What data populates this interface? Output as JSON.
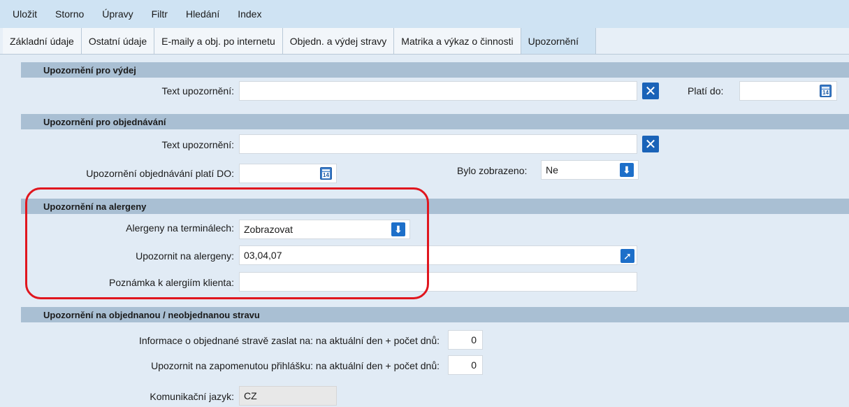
{
  "menu": [
    "Uložit",
    "Storno",
    "Úpravy",
    "Filtr",
    "Hledání",
    "Index"
  ],
  "tabs": [
    "Základní údaje",
    "Ostatní údaje",
    "E-maily a obj. po internetu",
    "Objedn. a výdej stravy",
    "Matrika a výkaz o činnosti",
    "Upozornění"
  ],
  "active_tab": "Upozornění",
  "s1": {
    "header": "Upozornění pro výdej",
    "text_label": "Text upozornění:",
    "text_value": "",
    "valid_label": "Platí do:",
    "valid_value": ""
  },
  "s2": {
    "header": "Upozornění pro objednávání",
    "text_label": "Text upozornění:",
    "text_value": "",
    "date_label": "Upozornění objednávání platí DO:",
    "date_value": "",
    "shown_label": "Bylo zobrazeno:",
    "shown_value": "Ne"
  },
  "s3": {
    "header": "Upozornění na alergeny",
    "terminals_label": "Alergeny na terminálech:",
    "terminals_value": "Zobrazovat",
    "notify_label": "Upozornit na alergeny:",
    "notify_value": "03,04,07",
    "note_label": "Poznámka k alergiím klienta:",
    "note_value": ""
  },
  "s4": {
    "header": "Upozornění na objednanou / neobjednanou stravu",
    "info_label": "Informace o objednané stravě zaslat na: na aktuální den + počet dnů:",
    "info_value": "0",
    "forgot_label": "Upozornit na zapomenutou přihlášku: na aktuální den + počet dnů:",
    "forgot_value": "0"
  },
  "lang": {
    "label": "Komunikační jazyk:",
    "value": "CZ"
  },
  "colors": {
    "accent": "#1d6fc9",
    "highlight": "#e0161e",
    "section": "#a9bfd3",
    "panel": "#e1ebf5"
  }
}
